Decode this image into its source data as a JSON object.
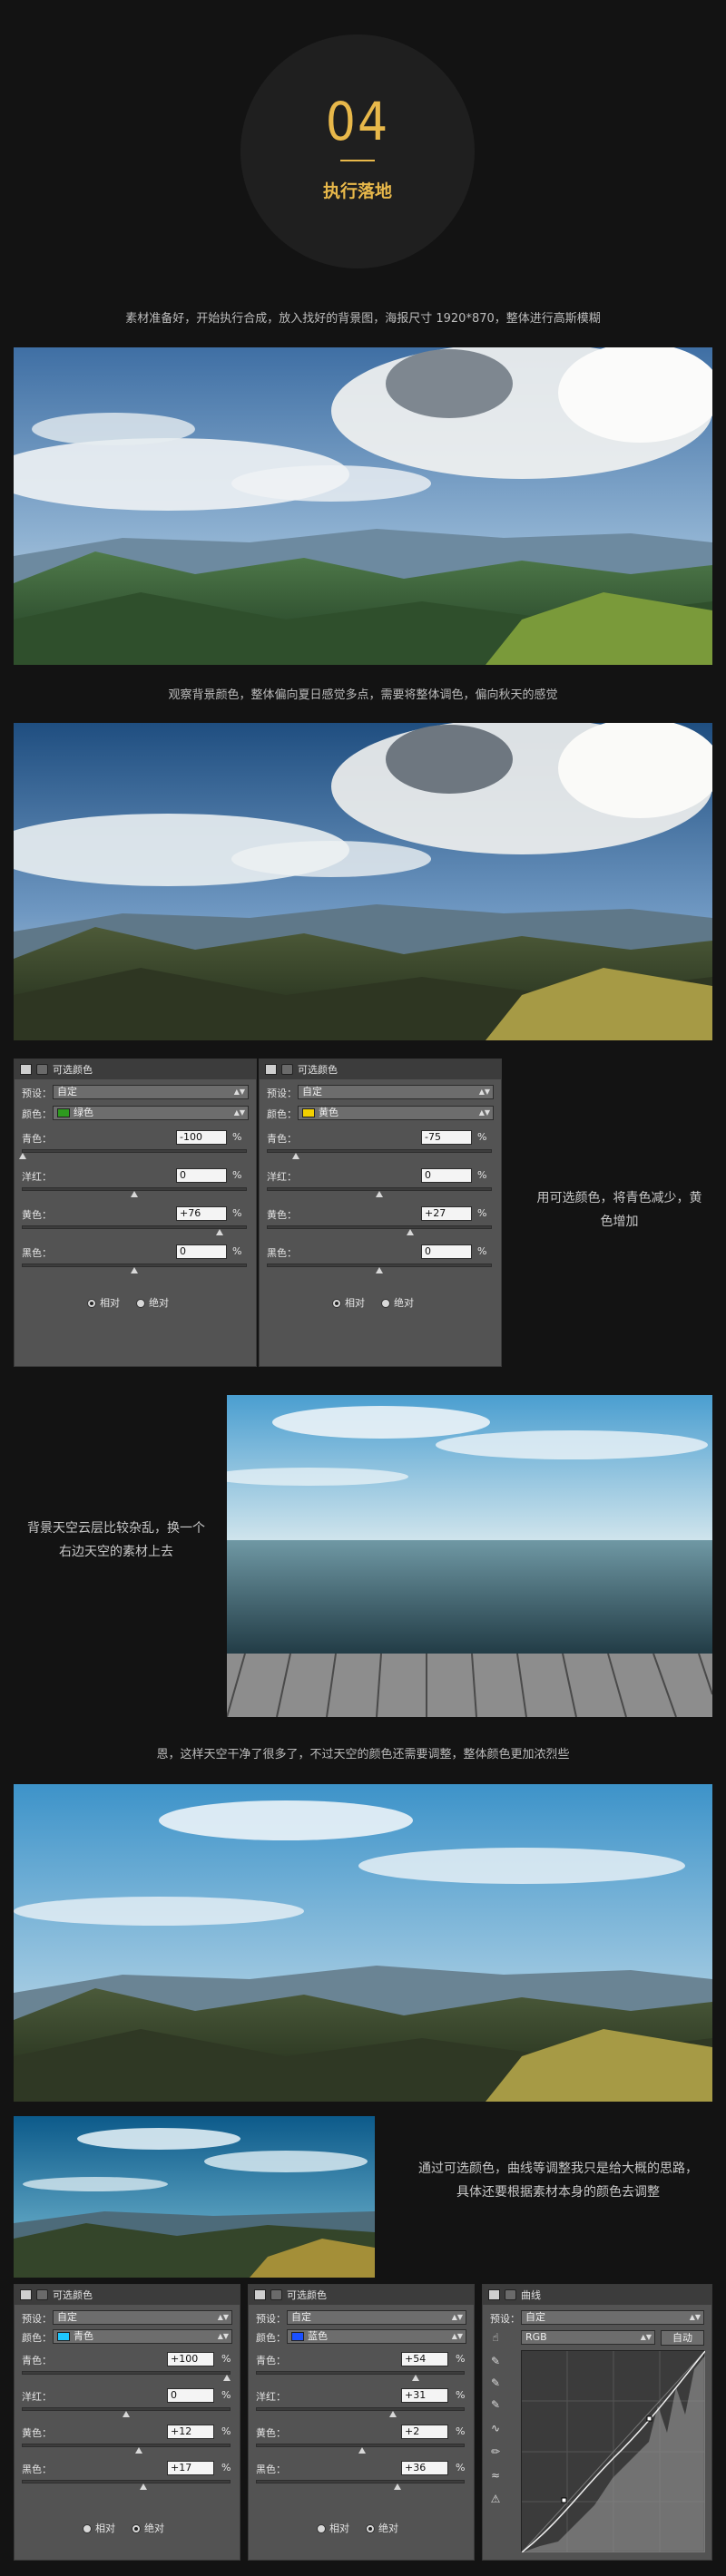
{
  "header": {
    "number": "04",
    "title": "执行落地"
  },
  "captions": {
    "c1": "素材准备好，开始执行合成，放入找好的背景图，海报尺寸 1920*870，整体进行高斯模糊",
    "c2": "观察背景颜色，整体偏向夏日感觉多点，需要将整体调色，偏向秋天的感觉",
    "c3": "恩，这样天空干净了很多了，不过天空的颜色还需要调整，整体颜色更加浓烈些"
  },
  "side_texts": {
    "s1": "用可选颜色，将青色减少，黄色增加",
    "s2": "背景天空云层比较杂乱，换一个右边天空的素材上去",
    "s3": "通过可选颜色，曲线等调整我只是给大概的思路，具体还要根据素材本身的颜色去调整"
  },
  "panel_labels": {
    "title": "可选颜色",
    "preset": "预设：",
    "preset_value": "自定",
    "color": "颜色：",
    "cyan": "青色：",
    "magenta": "洋红：",
    "yellow": "黄色：",
    "black": "黑色：",
    "pct": "%",
    "relative": "相对",
    "absolute": "绝对"
  },
  "panels_row1": [
    {
      "color_name": "绿色",
      "swatch": "#2e9a1f",
      "cyan": "-100",
      "magenta": "0",
      "yellow": "+76",
      "black": "0",
      "mode": "relative"
    },
    {
      "color_name": "黄色",
      "swatch": "#f2d000",
      "cyan": "-75",
      "magenta": "0",
      "yellow": "+27",
      "black": "0",
      "mode": "relative"
    }
  ],
  "panels_row2": [
    {
      "color_name": "青色",
      "swatch": "#1ec8ff",
      "cyan": "+100",
      "magenta": "0",
      "yellow": "+12",
      "black": "+17",
      "mode": "absolute"
    },
    {
      "color_name": "蓝色",
      "swatch": "#1a50ff",
      "cyan": "+54",
      "magenta": "+31",
      "yellow": "+2",
      "black": "+36",
      "mode": "absolute"
    }
  ],
  "curves": {
    "title": "曲线",
    "preset": "预设：",
    "preset_value": "自定",
    "channel": "RGB",
    "auto": "自动"
  },
  "colors": {
    "accent": "#e8b84a",
    "background": "#131313"
  }
}
